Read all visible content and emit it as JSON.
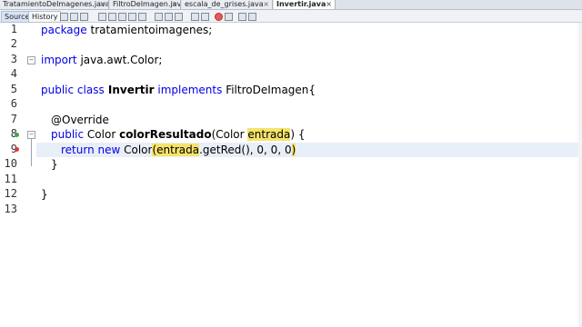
{
  "tabs": [
    {
      "label": "TratamientoDeImagenes.java"
    },
    {
      "label": "FiltroDeImagen.java"
    },
    {
      "label": "escala_de_grises.java"
    },
    {
      "label": "Invertir.java"
    }
  ],
  "toolbar": {
    "source_label": "Source",
    "history_label": "History"
  },
  "lines": [
    {
      "n": "1"
    },
    {
      "n": "2"
    },
    {
      "n": "3"
    },
    {
      "n": "4"
    },
    {
      "n": "5"
    },
    {
      "n": "6"
    },
    {
      "n": "7"
    },
    {
      "n": "8"
    },
    {
      "n": "9"
    },
    {
      "n": "10"
    },
    {
      "n": "11"
    },
    {
      "n": "12"
    },
    {
      "n": "13"
    }
  ],
  "code": {
    "l1_kw": "package",
    "l1_rest": " tratamientoimagenes;",
    "l3_kw": "import",
    "l3_rest": " java.awt.Color;",
    "l5_kw1": "public class",
    "l5_name": " Invertir",
    "l5_kw2": " implements",
    "l5_rest": " FiltroDeImagen{",
    "l7": "@Override",
    "l8_kw": "public",
    "l8_type": " Color ",
    "l8_name": "colorResultado",
    "l8_rest1": "(Color ",
    "l8_param": "entrada",
    "l8_rest2": ") {",
    "l9_kw": "return new",
    "l9_a": " Color",
    "l9_paren": "(",
    "l9_entrada": "entrada",
    "l9_b": ".getRed(",
    "l9_c": "), 0, 0, 0",
    "l9_close": ")",
    "l10": "}",
    "l12": "}"
  },
  "colors": {
    "keyword": "#0000e6",
    "highlight": "#f5e36b",
    "breakpoint": "#e03a3a",
    "override_marker": "#3fa34d"
  }
}
